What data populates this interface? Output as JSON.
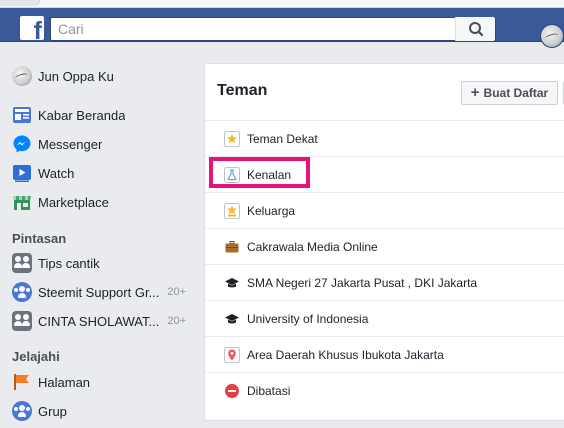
{
  "header": {
    "search_placeholder": "Cari"
  },
  "sidebar": {
    "profile_name": "Jun Oppa Ku",
    "items": [
      {
        "label": "Kabar Beranda",
        "icon": "news-feed-icon"
      },
      {
        "label": "Messenger",
        "icon": "messenger-icon"
      },
      {
        "label": "Watch",
        "icon": "watch-icon"
      },
      {
        "label": "Marketplace",
        "icon": "marketplace-icon"
      }
    ],
    "shortcuts_title": "Pintasan",
    "shortcuts": [
      {
        "label": "Tips cantik",
        "count": "",
        "icon": "group-icon"
      },
      {
        "label": "Steemit Support Gr...",
        "count": "20+",
        "icon": "group-icon"
      },
      {
        "label": "CINTA SHOLAWAT...",
        "count": "20+",
        "icon": "group-icon"
      }
    ],
    "explore_title": "Jelajahi",
    "explore": [
      {
        "label": "Halaman",
        "icon": "pages-flag-icon"
      },
      {
        "label": "Grup",
        "icon": "groups-icon"
      }
    ]
  },
  "panel": {
    "title": "Teman",
    "create_button": "Buat Daftar",
    "create_button_icon": "+",
    "lists": [
      {
        "label": "Teman Dekat",
        "icon": "star-icon"
      },
      {
        "label": "Kenalan",
        "icon": "flask-icon"
      },
      {
        "label": "Keluarga",
        "icon": "house-star-icon"
      },
      {
        "label": "Cakrawala Media Online",
        "icon": "briefcase-icon"
      },
      {
        "label": "SMA Negeri 27 Jakarta Pusat , DKI Jakarta",
        "icon": "graduation-cap-icon"
      },
      {
        "label": "University of Indonesia",
        "icon": "graduation-cap-icon"
      },
      {
        "label": "Area Daerah Khusus Ibukota Jakarta",
        "icon": "location-pin-icon"
      },
      {
        "label": "Dibatasi",
        "icon": "restricted-icon"
      }
    ]
  },
  "colors": {
    "header_bg": "#3b5998",
    "page_bg": "#e9ebee",
    "highlight": "#e3137b"
  }
}
